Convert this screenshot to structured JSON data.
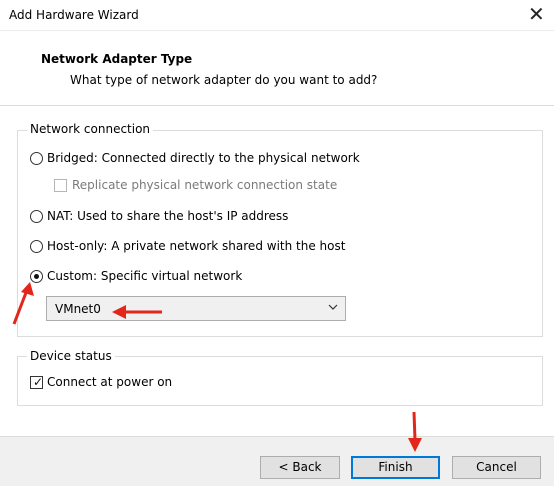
{
  "window": {
    "title": "Add Hardware Wizard",
    "close_icon": "close-icon"
  },
  "header": {
    "title": "Network Adapter Type",
    "subtitle": "What type of network adapter do you want to add?"
  },
  "network_connection": {
    "group_label": "Network connection",
    "options": [
      {
        "label": "Bridged: Connected directly to the physical network",
        "checked": false
      },
      {
        "label": "NAT: Used to share the host's IP address",
        "checked": false
      },
      {
        "label": "Host-only: A private network shared with the host",
        "checked": false
      },
      {
        "label": "Custom: Specific virtual network",
        "checked": true
      }
    ],
    "replicate_label": "Replicate physical network connection state",
    "replicate_checked": false,
    "custom_network_value": "VMnet0"
  },
  "device_status": {
    "group_label": "Device status",
    "connect_label": "Connect at power on",
    "connect_checked": true
  },
  "footer": {
    "back_label": "< Back",
    "finish_label": "Finish",
    "cancel_label": "Cancel"
  },
  "colors": {
    "annotation_arrow": "#e3261b",
    "default_button_border": "#0078d7"
  }
}
